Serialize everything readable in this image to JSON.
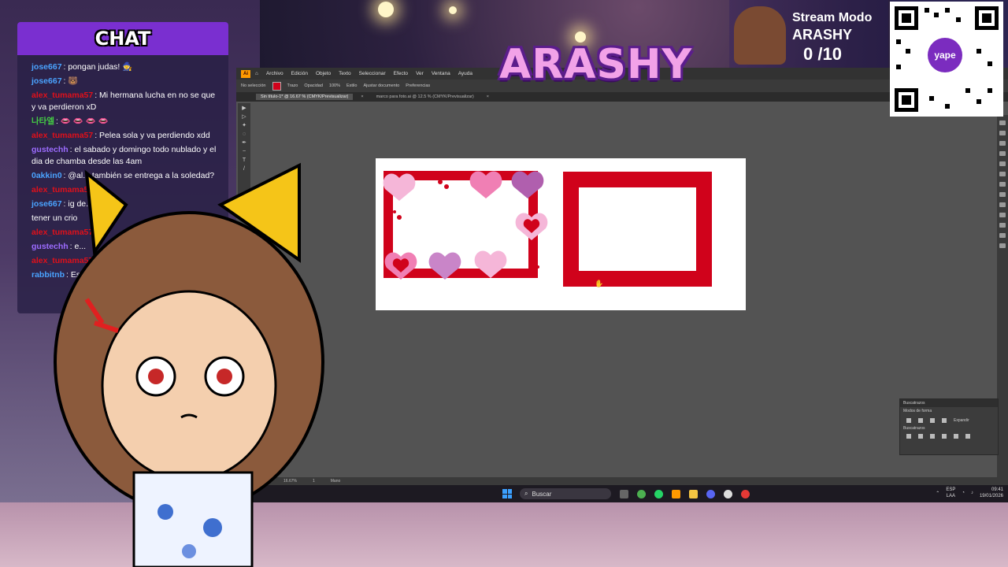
{
  "chat": {
    "title": "CHAT",
    "messages": [
      {
        "user": "jose667",
        "text": ": pongan judas! 🧙",
        "color": "#4aa3ff"
      },
      {
        "user": "jose667",
        "text": ": 🐻",
        "color": "#4aa3ff"
      },
      {
        "user": "alex_tumama57",
        "text": ": Mi hermana lucha en no se que y va perdieron xD",
        "color": "#e0101a"
      },
      {
        "user": "나타엘",
        "text": ": 👄 👄 👄 👄",
        "color": "#44cc44"
      },
      {
        "user": "alex_tumama57",
        "text": ": Pelea sola y va perdiendo xdd",
        "color": "#e0101a"
      },
      {
        "user": "gustechh",
        "text": ": el sabado y domingo todo nublado y el dia de chamba desde las 4am",
        "color": "#9c6cff"
      },
      {
        "user": "0akkin0",
        "text": ": @al... también se entrega a la soledad?",
        "color": "#4aa3ff"
      },
      {
        "user": "alex_tumama57",
        "text": "",
        "color": "#e0101a"
      },
      {
        "user": "jose667",
        "text": ": ig de...",
        "color": "#4aa3ff"
      },
      {
        "user": "",
        "text": "tener un crio",
        "color": "#ffffff"
      },
      {
        "user": "alex_tumama57",
        "text": "",
        "color": "#e0101a"
      },
      {
        "user": "gustechh",
        "text": ": e...",
        "color": "#9c6cff"
      },
      {
        "user": "alex_tumama57",
        "text": "",
        "color": "#e0101a"
      },
      {
        "user": "rabbitnb",
        "text": ": Esta...",
        "color": "#4aa3ff"
      }
    ]
  },
  "illustrator": {
    "app_icon": "Ai",
    "menu": [
      "Archivo",
      "Edición",
      "Objeto",
      "Texto",
      "Seleccionar",
      "Efecto",
      "Ver",
      "Ventana",
      "Ayuda"
    ],
    "control": {
      "selection": "No selección",
      "stroke_label": "Trazo",
      "opacity_label": "Opacidad",
      "opacity_value": "100%",
      "style_label": "Estilo",
      "doc_setup": "Ajustar documento",
      "prefs": "Preferencias",
      "fill_color": "#d0021b"
    },
    "tabs": [
      {
        "label": "Sin título-1* @ 16.67 % (CMYK/Previsualizar)",
        "active": true
      },
      {
        "label": "marco para foto.ai @ 12.5 % (CMYK/Previsualizar)",
        "active": false
      }
    ],
    "panel": {
      "title": "Buscatrazos",
      "section1": "Modos de forma",
      "section2": "Buscatrazos",
      "expand": "Expandir"
    },
    "status": {
      "zoom": "16.67%",
      "page": "1",
      "mode": "Mano"
    }
  },
  "taskbar": {
    "search_placeholder": "Buscar",
    "lang": "ESP",
    "region": "LAA",
    "time": "09:41",
    "date": "19/01/2026"
  },
  "overlay": {
    "logo": "ARASHY",
    "stream_line1": "Stream Modo",
    "stream_line2": "ARASHY",
    "counter": "0 /10",
    "qr_badge": "yape"
  },
  "colors": {
    "frame_red": "#d0021b",
    "chat_header": "#7a2fd0",
    "heart_pink": "#f5b6d8",
    "heart_purple": "#b05fae"
  }
}
